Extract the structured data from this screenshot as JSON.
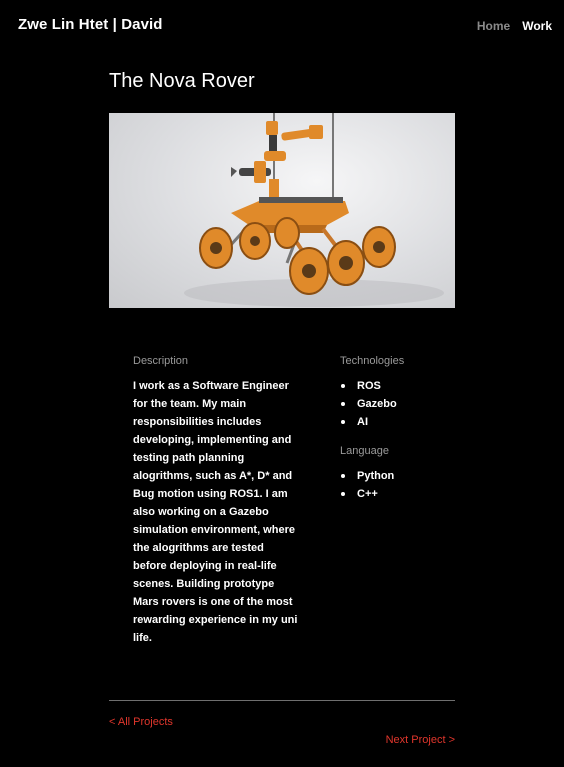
{
  "header": {
    "brand": "Zwe Lin Htet | David",
    "nav": {
      "home": "Home",
      "work": "Work"
    }
  },
  "project": {
    "title": "The Nova Rover",
    "description_label": "Description",
    "description": "I work as a Software Engineer for the team. My main responsibilities includes developing, implementing and testing path planning alogrithms, such as A*, D* and Bug motion using ROS1. I am also working on a Gazebo simulation environment, where the alogrithms are tested before deploying in real-life scenes. Building prototype Mars rovers is one of the most rewarding experience in my uni life.",
    "technologies_label": "Technologies",
    "technologies": [
      "ROS",
      "Gazebo",
      "AI"
    ],
    "language_label": "Language",
    "languages": [
      "Python",
      "C++"
    ]
  },
  "footer": {
    "prev": "< All Projects",
    "next": "Next Project >"
  },
  "colors": {
    "background": "#000000",
    "accent_link": "#e0362c",
    "rover_orange": "#e08a2a"
  }
}
